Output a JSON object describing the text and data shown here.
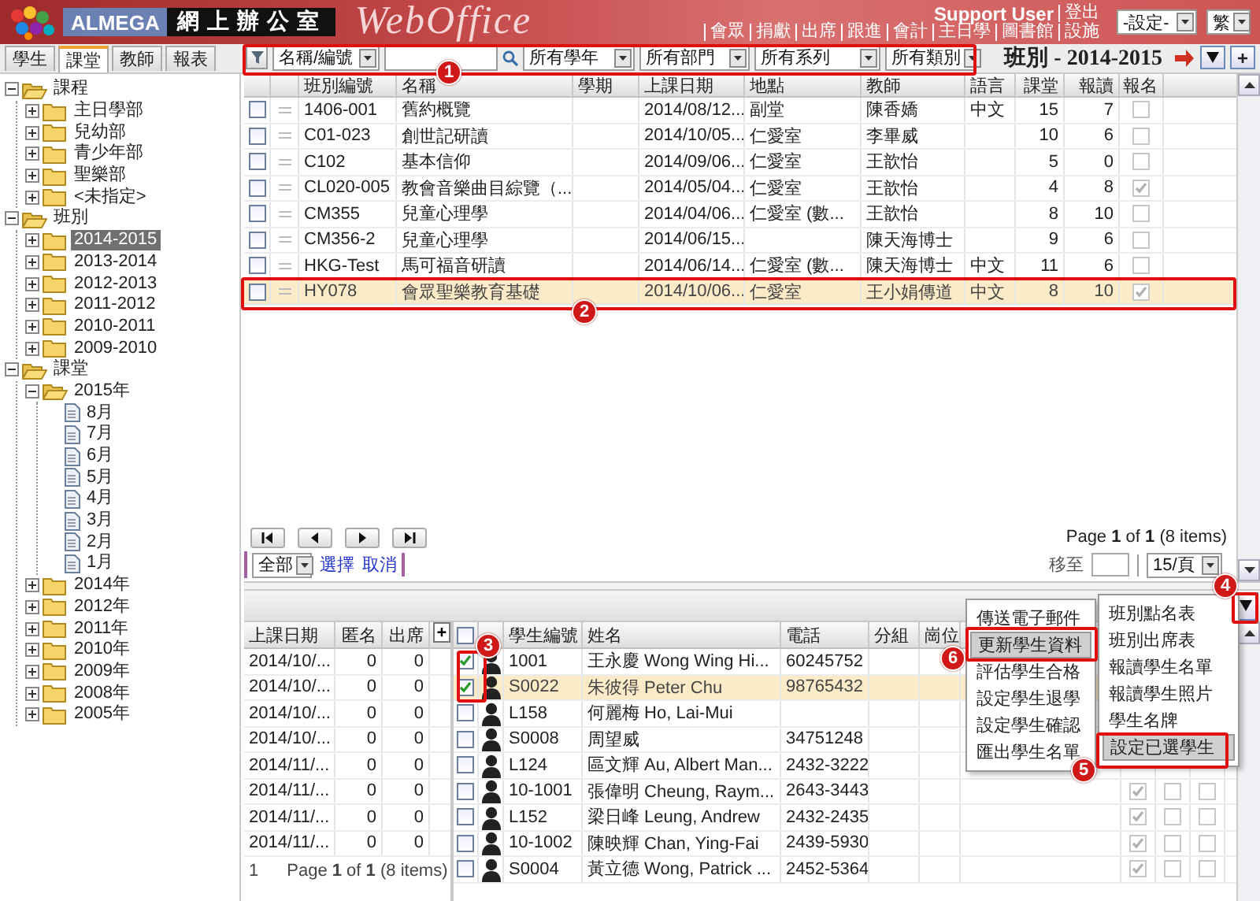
{
  "header": {
    "brand": "ALMEGA",
    "title": "網上辦公室",
    "product": "WebOffice",
    "user": "Support User",
    "logout": "登出",
    "links": [
      "會眾",
      "捐獻",
      "出席",
      "跟進",
      "會計",
      "主日學",
      "圖書館",
      "設施"
    ],
    "settings_select": "-設定-",
    "language_select": "繁"
  },
  "side_tabs": [
    {
      "label": "學生",
      "selected": false
    },
    {
      "label": "課堂",
      "selected": true
    },
    {
      "label": "教師",
      "selected": false
    },
    {
      "label": "報表",
      "selected": false
    }
  ],
  "toolbar": {
    "field_select": "名稱/編號",
    "filters": [
      "所有學年",
      "所有部門",
      "所有系列",
      "所有類別"
    ],
    "heading": "班別 - 2014-2015",
    "add_button": "+"
  },
  "tree": [
    {
      "label": "課程",
      "kind": "folder",
      "expanded": true,
      "selected": false,
      "children": [
        {
          "label": "主日學部",
          "kind": "folder",
          "expanded": false,
          "selected": false
        },
        {
          "label": "兒幼部",
          "kind": "folder",
          "expanded": false,
          "selected": false
        },
        {
          "label": "青少年部",
          "kind": "folder",
          "expanded": false,
          "selected": false
        },
        {
          "label": "聖樂部",
          "kind": "folder",
          "expanded": false,
          "selected": false
        },
        {
          "label": "<未指定>",
          "kind": "folder",
          "expanded": false,
          "selected": false
        }
      ]
    },
    {
      "label": "班別",
      "kind": "folder",
      "expanded": true,
      "selected": false,
      "children": [
        {
          "label": "2014-2015",
          "kind": "folder",
          "expanded": false,
          "selected": true
        },
        {
          "label": "2013-2014",
          "kind": "folder",
          "expanded": false,
          "selected": false
        },
        {
          "label": "2012-2013",
          "kind": "folder",
          "expanded": false,
          "selected": false
        },
        {
          "label": "2011-2012",
          "kind": "folder",
          "expanded": false,
          "selected": false
        },
        {
          "label": "2010-2011",
          "kind": "folder",
          "expanded": false,
          "selected": false
        },
        {
          "label": "2009-2010",
          "kind": "folder",
          "expanded": false,
          "selected": false
        }
      ]
    },
    {
      "label": "課堂",
      "kind": "folder",
      "expanded": true,
      "selected": false,
      "children": [
        {
          "label": "2015年",
          "kind": "folder",
          "expanded": true,
          "selected": false,
          "children": [
            {
              "label": "8月",
              "kind": "leaf",
              "selected": false
            },
            {
              "label": "7月",
              "kind": "leaf",
              "selected": false
            },
            {
              "label": "6月",
              "kind": "leaf",
              "selected": false
            },
            {
              "label": "5月",
              "kind": "leaf",
              "selected": false
            },
            {
              "label": "4月",
              "kind": "leaf",
              "selected": false
            },
            {
              "label": "3月",
              "kind": "leaf",
              "selected": false
            },
            {
              "label": "2月",
              "kind": "leaf",
              "selected": false
            },
            {
              "label": "1月",
              "kind": "leaf",
              "selected": false
            }
          ]
        },
        {
          "label": "2014年",
          "kind": "folder",
          "expanded": false,
          "selected": false
        },
        {
          "label": "2012年",
          "kind": "folder",
          "expanded": false,
          "selected": false
        },
        {
          "label": "2011年",
          "kind": "folder",
          "expanded": false,
          "selected": false
        },
        {
          "label": "2010年",
          "kind": "folder",
          "expanded": false,
          "selected": false
        },
        {
          "label": "2009年",
          "kind": "folder",
          "expanded": false,
          "selected": false
        },
        {
          "label": "2008年",
          "kind": "folder",
          "expanded": false,
          "selected": false
        },
        {
          "label": "2005年",
          "kind": "folder",
          "expanded": false,
          "selected": false
        }
      ]
    }
  ],
  "class_table": {
    "columns": [
      "班別編號",
      "名稱",
      "學期",
      "上課日期",
      "地點",
      "教師",
      "語言",
      "課堂",
      "報讀",
      "報名"
    ],
    "rows": [
      {
        "checked": false,
        "selected": false,
        "code": "1406-001",
        "name": "舊約概覽",
        "date": "2014/08/12...",
        "place": "副堂",
        "teacher": "陳香嬌",
        "language": "中文",
        "sessions": "15",
        "enrolled": "7",
        "registration": false
      },
      {
        "checked": false,
        "selected": false,
        "code": "C01-023",
        "name": "創世記研讀",
        "date": "2014/10/05...",
        "place": "仁愛室",
        "teacher": "李畢威",
        "sessions": "10",
        "enrolled": "6",
        "registration": false
      },
      {
        "checked": false,
        "selected": false,
        "code": "C102",
        "name": "基本信仰",
        "date": "2014/09/06...",
        "place": "仁愛室",
        "teacher": "王歆怡",
        "sessions": "5",
        "enrolled": "0",
        "registration": false
      },
      {
        "checked": false,
        "selected": false,
        "code": "CL020-005",
        "name": "教會音樂曲目綜覽（...",
        "date": "2014/05/04...",
        "place": "仁愛室",
        "teacher": "王歆怡",
        "sessions": "4",
        "enrolled": "8",
        "registration": true
      },
      {
        "checked": false,
        "selected": false,
        "code": "CM355",
        "name": "兒童心理學",
        "date": "2014/04/06...",
        "place": "仁愛室 (數...",
        "teacher": "王歆怡",
        "sessions": "8",
        "enrolled": "10",
        "registration": false
      },
      {
        "checked": false,
        "selected": false,
        "code": "CM356-2",
        "name": "兒童心理學",
        "date": "2014/06/15...",
        "teacher": "陳天海博士",
        "sessions": "9",
        "enrolled": "6",
        "registration": false
      },
      {
        "checked": false,
        "selected": false,
        "code": "HKG-Test",
        "name": "馬可福音研讀",
        "date": "2014/06/14...",
        "place": "仁愛室 (數...",
        "teacher": "陳天海博士",
        "language": "中文",
        "sessions": "11",
        "enrolled": "6",
        "registration": false
      },
      {
        "checked": false,
        "selected": true,
        "code": "HY078",
        "name": "會眾聖樂教育基礎",
        "date": "2014/10/06...",
        "place": "仁愛室",
        "teacher": "王小娟傳道",
        "language": "中文",
        "sessions": "8",
        "enrolled": "10",
        "registration": true
      }
    ]
  },
  "pager": {
    "info": "Page **1** of **1** (8 items)",
    "scope_select": "全部",
    "select_link": "選擇",
    "cancel_link": "取消",
    "goto_label": "移至",
    "page_size": "15/頁"
  },
  "session_table": {
    "columns": [
      "上課日期",
      "匿名",
      "出席"
    ],
    "add_button": "+",
    "rows": [
      {
        "date": "2014/10/...",
        "anonymous": "0",
        "attended": "0"
      },
      {
        "date": "2014/10/...",
        "anonymous": "0",
        "attended": "0"
      },
      {
        "date": "2014/10/...",
        "anonymous": "0",
        "attended": "0"
      },
      {
        "date": "2014/10/...",
        "anonymous": "0",
        "attended": "0"
      },
      {
        "date": "2014/11/...",
        "anonymous": "0",
        "attended": "0"
      },
      {
        "date": "2014/11/...",
        "anonymous": "0",
        "attended": "0"
      },
      {
        "date": "2014/11/...",
        "anonymous": "0",
        "attended": "0"
      },
      {
        "date": "2014/11/...",
        "anonymous": "0",
        "attended": "0"
      }
    ],
    "footer_page": "1",
    "footer_info": "Page **1** of **1** (8 items)"
  },
  "student_table": {
    "all_checked": false,
    "columns": [
      "學生編號",
      "姓名",
      "電話",
      "分組",
      "崗位"
    ],
    "rows": [
      {
        "checked": true,
        "selected": false,
        "id": "1001",
        "name": "王永慶 Wong Wing Hi...",
        "phone": "60245752"
      },
      {
        "checked": true,
        "selected": true,
        "id": "S0022",
        "name": "朱彼得 Peter Chu",
        "phone": "98765432"
      },
      {
        "checked": false,
        "selected": false,
        "id": "L158",
        "name": "何麗梅 Ho, Lai-Mui"
      },
      {
        "checked": false,
        "selected": false,
        "id": "S0008",
        "name": "周望威",
        "phone": "34751248"
      },
      {
        "checked": false,
        "selected": false,
        "id": "L124",
        "name": "區文輝 Au, Albert Man...",
        "phone": "2432-3222"
      },
      {
        "checked": false,
        "selected": false,
        "id": "10-1001",
        "name": "張偉明 Cheung, Raym...",
        "phone": "2643-3443",
        "flags": [
          true,
          false,
          false
        ]
      },
      {
        "checked": false,
        "selected": false,
        "id": "L152",
        "name": "梁日峰 Leung, Andrew",
        "phone": "2432-2435",
        "flags": [
          true,
          false,
          false
        ]
      },
      {
        "checked": false,
        "selected": false,
        "id": "10-1002",
        "name": "陳映輝 Chan, Ying-Fai",
        "phone": "2439-5930",
        "flags": [
          true,
          false,
          false
        ]
      },
      {
        "checked": false,
        "selected": false,
        "id": "S0004",
        "name": "黃立德 Wong, Patrick ...",
        "phone": "2452-5364",
        "flags": [
          true,
          false,
          false
        ]
      }
    ]
  },
  "action_menu": [
    {
      "label": "傳送電子郵件",
      "selected": false
    },
    {
      "label": "更新學生資料",
      "selected": true
    },
    {
      "label": "評估學生合格",
      "selected": false
    },
    {
      "label": "設定學生退學",
      "selected": false
    },
    {
      "label": "設定學生確認",
      "selected": false
    },
    {
      "label": "匯出學生名單",
      "selected": false
    }
  ],
  "report_menu": [
    {
      "label": "班別點名表",
      "selected": false
    },
    {
      "label": "班別出席表",
      "selected": false
    },
    {
      "label": "報讀學生名單",
      "selected": false
    },
    {
      "label": "報讀學生照片",
      "selected": false
    },
    {
      "label": "學生名牌",
      "selected": false
    },
    {
      "label": "設定已選學生",
      "selected": true
    }
  ],
  "callouts": [
    "1",
    "2",
    "3",
    "4",
    "5",
    "6"
  ]
}
